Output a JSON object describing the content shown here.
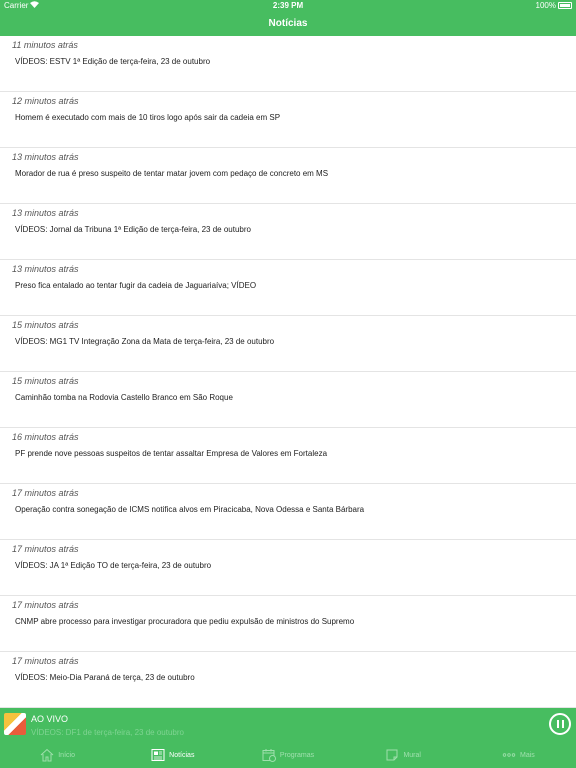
{
  "status_bar": {
    "carrier": "Carrier",
    "time": "2:39 PM",
    "battery": "100%"
  },
  "nav": {
    "title": "Notícias"
  },
  "news": [
    {
      "time_ago": "11 minutos atrás",
      "headline": "VÍDEOS: ESTV 1ª Edição de terça-feira, 23 de outubro"
    },
    {
      "time_ago": "12 minutos atrás",
      "headline": "Homem é executado com mais de 10 tiros logo após sair da cadeia em SP"
    },
    {
      "time_ago": "13 minutos atrás",
      "headline": "Morador de rua é preso suspeito de tentar matar jovem com pedaço de concreto em MS"
    },
    {
      "time_ago": "13 minutos atrás",
      "headline": "VÍDEOS: Jornal da Tribuna 1ª Edição de terça-feira, 23 de outubro"
    },
    {
      "time_ago": "13 minutos atrás",
      "headline": "Preso fica entalado ao tentar fugir da cadeia de Jaguariaíva; VÍDEO"
    },
    {
      "time_ago": "15 minutos atrás",
      "headline": "VÍDEOS: MG1 TV Integração Zona da Mata de terça-feira, 23 de outubro"
    },
    {
      "time_ago": "15 minutos atrás",
      "headline": "Caminhão tomba na Rodovia Castello Branco em São Roque"
    },
    {
      "time_ago": "16 minutos atrás",
      "headline": "PF prende nove pessoas suspeitos de tentar assaltar Empresa de Valores em Fortaleza"
    },
    {
      "time_ago": "17 minutos atrás",
      "headline": "Operação contra sonegação de ICMS notifica alvos em Piracicaba, Nova Odessa e Santa Bárbara"
    },
    {
      "time_ago": "17 minutos atrás",
      "headline": "VÍDEOS: JA 1ª Edição TO de terça-feira, 23 de outubro"
    },
    {
      "time_ago": "17 minutos atrás",
      "headline": "CNMP abre processo para investigar procuradora que pediu expulsão de ministros do Supremo"
    },
    {
      "time_ago": "17 minutos atrás",
      "headline": "VÍDEOS: Meio-Dia Paraná de terça, 23 de outubro"
    }
  ],
  "live_player": {
    "label": "AO VIVO",
    "subtitle": "VÍDEOS: DF1 de terça-feira, 23 de outubro"
  },
  "tabs": [
    {
      "label": "Início",
      "icon": "home-icon",
      "active": false
    },
    {
      "label": "Notícias",
      "icon": "news-icon",
      "active": true
    },
    {
      "label": "Programas",
      "icon": "calendar-icon",
      "active": false
    },
    {
      "label": "Mural",
      "icon": "note-icon",
      "active": false
    },
    {
      "label": "Mais",
      "icon": "more-icon",
      "active": false
    }
  ],
  "colors": {
    "brand_green": "#47bd60"
  }
}
